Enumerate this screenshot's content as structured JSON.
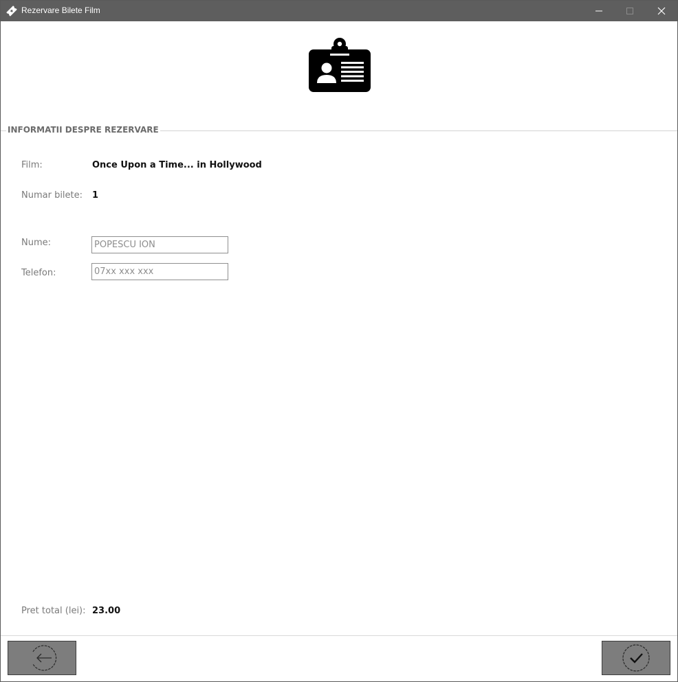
{
  "window": {
    "title": "Rezervare Bilete Film",
    "title_bar_color": "#5e5e5e",
    "app_icon": "ticket-icon",
    "header_icon": "id-badge-icon"
  },
  "reservation": {
    "group_title": "INFORMATII DESPRE REZERVARE",
    "film_label": "Film:",
    "film_value": "Once Upon a Time... in Hollywood",
    "tickets_label": "Numar bilete:",
    "tickets_value": "1",
    "name_label": "Nume:",
    "name_placeholder": "POPESCU ION",
    "phone_label": "Telefon:",
    "phone_placeholder": "07xx xxx xxx",
    "total_label": "Pret total (lei):",
    "total_value": "23.00"
  },
  "footer": {
    "back_icon": "back-arrow-icon",
    "confirm_icon": "checkmark-icon",
    "button_color": "#7d7d7d"
  }
}
